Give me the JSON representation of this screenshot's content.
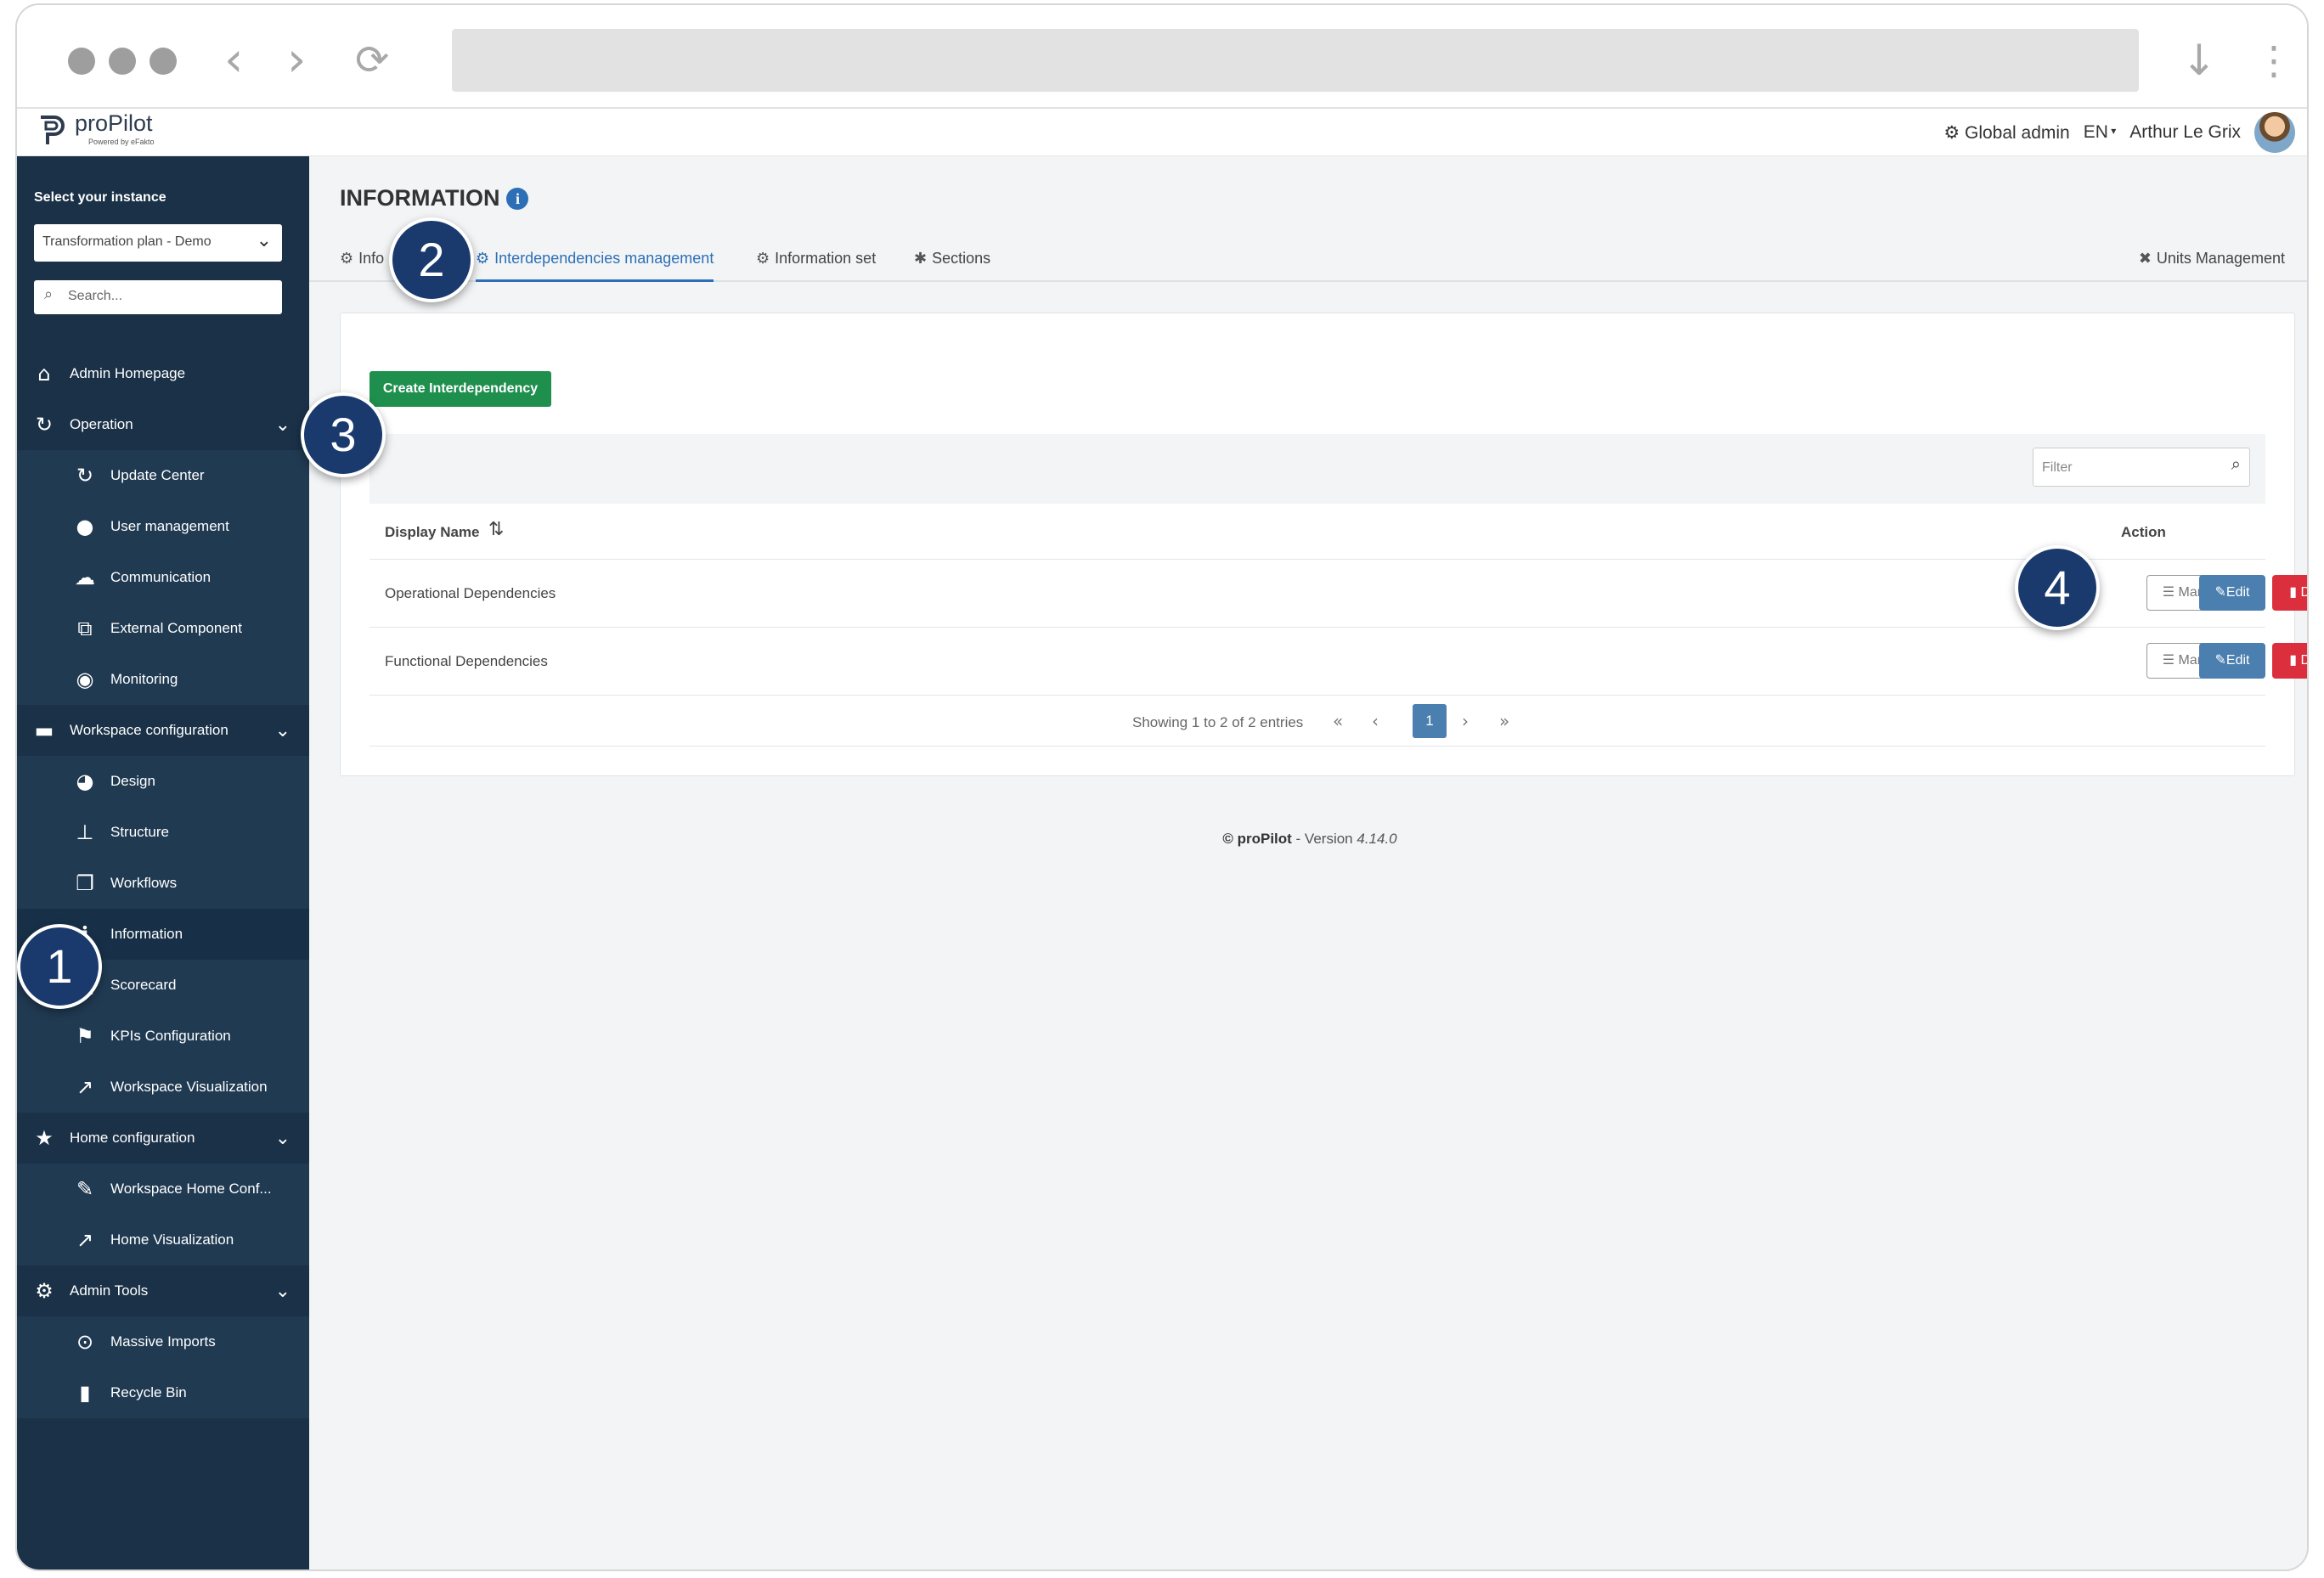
{
  "app": {
    "name": "proPilot",
    "tagline": "Powered by eFakto",
    "user_role": "Global admin",
    "language": "EN",
    "user_name": "Arthur Le Grix"
  },
  "sidebar": {
    "instance_title": "Select your instance",
    "instance_selected": "Transformation plan - Demo",
    "search_placeholder": "Search...",
    "items": [
      {
        "label": "Admin Homepage",
        "icon": "home-icon",
        "level": "top"
      },
      {
        "label": "Operation",
        "icon": "refresh-icon",
        "level": "top",
        "expandable": true
      },
      {
        "label": "Update Center",
        "icon": "refresh-icon",
        "level": "sub"
      },
      {
        "label": "User management",
        "icon": "user-icon",
        "level": "sub"
      },
      {
        "label": "Communication",
        "icon": "chat-icon",
        "level": "sub"
      },
      {
        "label": "External Component",
        "icon": "external-icon",
        "level": "sub"
      },
      {
        "label": "Monitoring",
        "icon": "eye-icon",
        "level": "sub"
      },
      {
        "label": "Workspace configuration",
        "icon": "folder-icon",
        "level": "top",
        "expandable": true
      },
      {
        "label": "Design",
        "icon": "palette-icon",
        "level": "sub"
      },
      {
        "label": "Structure",
        "icon": "sitemap-icon",
        "level": "sub"
      },
      {
        "label": "Workflows",
        "icon": "clone-icon",
        "level": "sub"
      },
      {
        "label": "Information",
        "icon": "info-icon",
        "level": "sub",
        "active": true
      },
      {
        "label": "Scorecard",
        "icon": "scorecard-icon",
        "level": "sub"
      },
      {
        "label": "KPIs Configuration",
        "icon": "flag-icon",
        "level": "sub"
      },
      {
        "label": "Workspace Visualization",
        "icon": "line-chart-icon",
        "level": "sub"
      },
      {
        "label": "Home configuration",
        "icon": "star-icon",
        "level": "top",
        "expandable": true
      },
      {
        "label": "Workspace Home Conf...",
        "icon": "edit-icon",
        "level": "sub"
      },
      {
        "label": "Home Visualization",
        "icon": "line-chart-icon",
        "level": "sub"
      },
      {
        "label": "Admin Tools",
        "icon": "gear-icon",
        "level": "top",
        "expandable": true
      },
      {
        "label": "Massive Imports",
        "icon": "download-icon",
        "level": "sub"
      },
      {
        "label": "Recycle Bin",
        "icon": "trash-icon",
        "level": "sub"
      }
    ]
  },
  "main": {
    "title": "INFORMATION",
    "tabs": [
      {
        "label": "Info",
        "icon": "gear-icon"
      },
      {
        "label": "Interdependencies management",
        "icon": "gear-icon",
        "active": true
      },
      {
        "label": "Information set",
        "icon": "gears-icon"
      },
      {
        "label": "Sections",
        "icon": "puzzle-icon"
      },
      {
        "label": "Units Management",
        "icon": "tools-icon"
      }
    ],
    "create_button": "Create Interdependency",
    "filter_placeholder": "Filter",
    "table": {
      "columns": [
        "Display Name",
        "Action"
      ],
      "rows": [
        {
          "name": "Operational Dependencies"
        },
        {
          "name": "Functional Dependencies"
        }
      ],
      "manage_label": "Manage",
      "edit_label": "Edit",
      "delete_label": "Delete"
    },
    "pagination": {
      "info": "Showing 1 to 2 of 2 entries",
      "current_page": "1"
    },
    "footer": {
      "copyright": "© proPilot",
      "version_prefix": " - Version ",
      "version": "4.14.0"
    }
  },
  "callouts": [
    "1",
    "2",
    "3",
    "4"
  ]
}
